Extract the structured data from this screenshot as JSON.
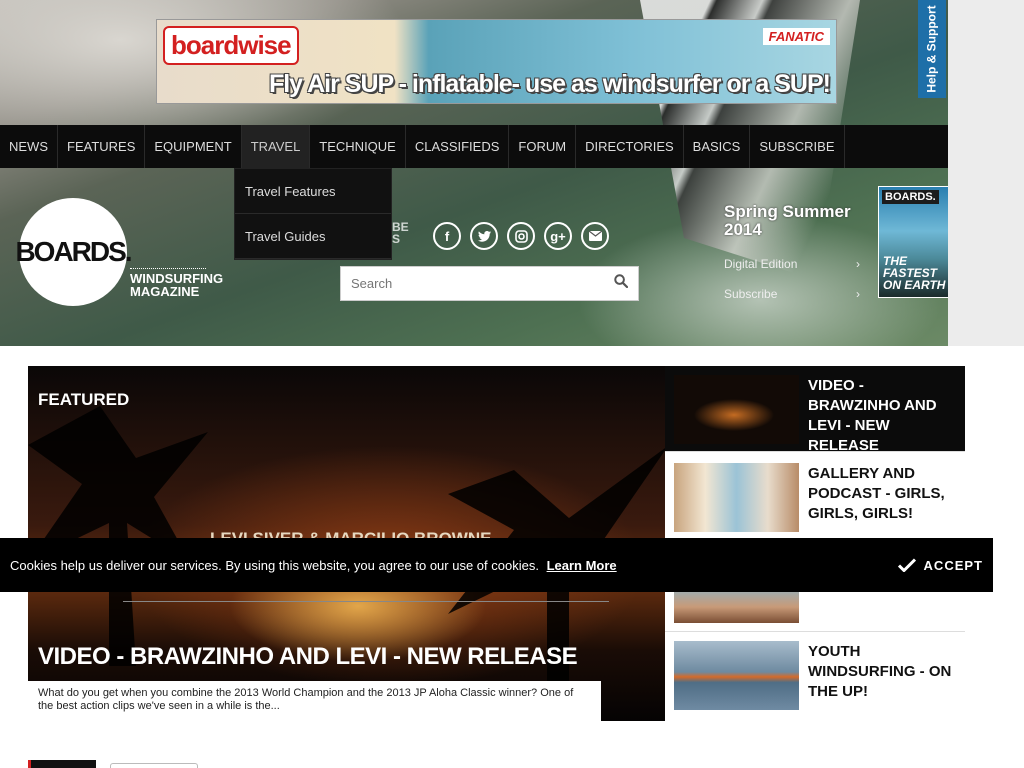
{
  "ad_banner": {
    "brand": "boardwise",
    "partner": "FANATIC",
    "tagline": "Fly Air SUP - inflatable- use as windsurfer or a SUP!"
  },
  "help_tab": "Help & Support",
  "nav": {
    "items": [
      "NEWS",
      "FEATURES",
      "EQUIPMENT",
      "TRAVEL",
      "TECHNIQUE",
      "CLASSIFIEDS",
      "FORUM",
      "DIRECTORIES",
      "BASICS",
      "SUBSCRIBE"
    ],
    "active": "TRAVEL",
    "dropdown": [
      "Travel Features",
      "Travel Guides"
    ]
  },
  "logo": {
    "name": "BOARDS.",
    "sub_line1": "WINDSURFING",
    "sub_line2": "MAGAZINE"
  },
  "ghost_text": {
    "line1": "BE",
    "line2": "S"
  },
  "social": [
    "f",
    "t",
    "ig",
    "g+",
    "mail"
  ],
  "search": {
    "placeholder": "Search"
  },
  "issue": {
    "title_line1": "Spring Summer",
    "title_line2": "2014",
    "link_digital": "Digital Edition",
    "link_subscribe": "Subscribe",
    "cover_name": "BOARDS.",
    "cover_tagline_line1": "THE FASTEST",
    "cover_tagline_line2": "ON EARTH"
  },
  "featured": {
    "label": "FEATURED",
    "headline": "VIDEO - BRAWZINHO AND LEVI - NEW RELEASE",
    "excerpt": "What do you get when you combine the 2013 World Champion and the 2013 JP Aloha Classic winner? One of the best action clips we've seen in a while is the...",
    "image_caption": "LEVI SIVER & MARCILIO BROWNE"
  },
  "side_articles": [
    {
      "title": "VIDEO - BRAWZINHO AND LEVI - NEW RELEASE"
    },
    {
      "title": "GALLERY AND PODCAST - GIRLS, GIRLS, GIRLS!"
    },
    {
      "title": "YOUTH WINDSURFING - ON THE UP!"
    }
  ],
  "cookie": {
    "message": "Cookies help us deliver our services. By using this website, you agree to our use of cookies.",
    "learn_more": "Learn More",
    "accept": "ACCEPT"
  }
}
